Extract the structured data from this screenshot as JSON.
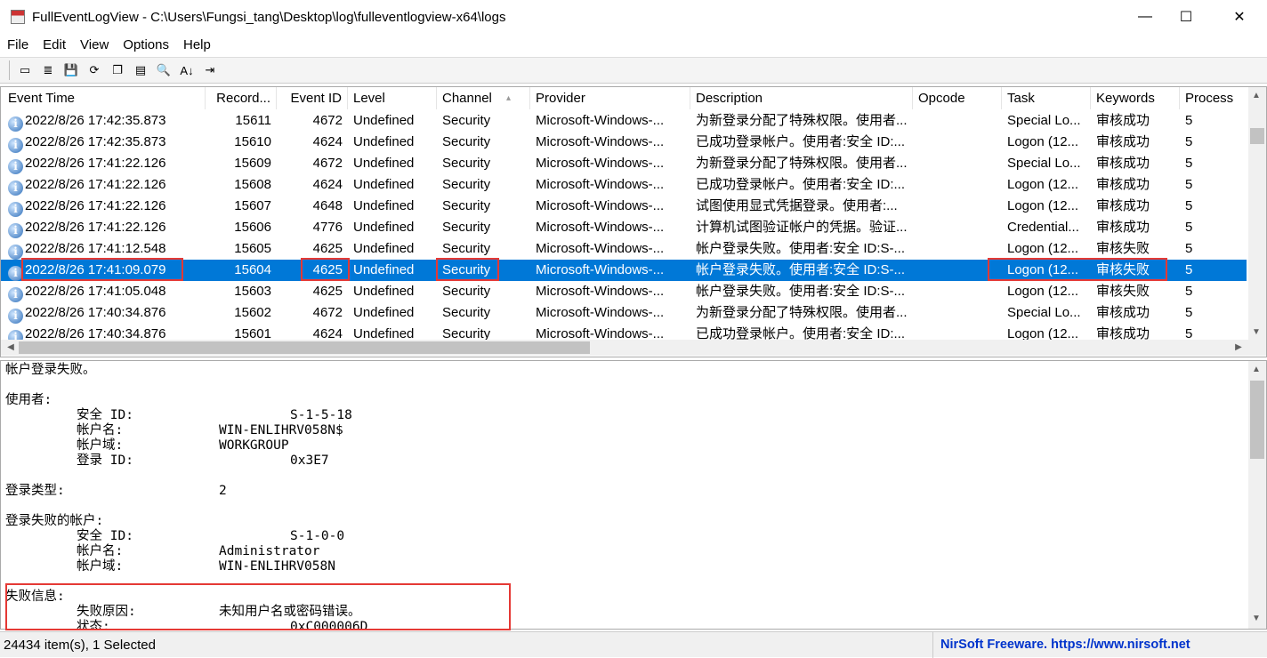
{
  "window": {
    "title": "FullEventLogView - C:\\Users\\Fungsi_tang\\Desktop\\log\\fulleventlogview-x64\\logs",
    "minimize": "—",
    "maximize": "☐",
    "close": "✕"
  },
  "menu": [
    "File",
    "Edit",
    "View",
    "Options",
    "Help"
  ],
  "toolbar": [
    {
      "icon": "properties-icon",
      "glyph": "▭"
    },
    {
      "icon": "database-icon",
      "glyph": "≣"
    },
    {
      "icon": "save-icon",
      "glyph": "💾"
    },
    {
      "icon": "refresh-icon",
      "glyph": "⟳"
    },
    {
      "icon": "copy-icon",
      "glyph": "❐"
    },
    {
      "icon": "html-report-icon",
      "glyph": "▤"
    },
    {
      "icon": "find-icon",
      "glyph": "🔍"
    },
    {
      "icon": "sort-icon",
      "glyph": "A↓"
    },
    {
      "icon": "exit-icon",
      "glyph": "⇥"
    }
  ],
  "columns": [
    "Event Time",
    "Record...",
    "Event ID",
    "Level",
    "Channel",
    "Provider",
    "Description",
    "Opcode",
    "Task",
    "Keywords",
    "Process"
  ],
  "rows": [
    [
      "2022/8/26 17:42:35.873",
      "15611",
      "4672",
      "Undefined",
      "Security",
      "Microsoft-Windows-...",
      "为新登录分配了特殊权限。使用者...",
      "",
      "Special Lo...",
      "审核成功",
      "5"
    ],
    [
      "2022/8/26 17:42:35.873",
      "15610",
      "4624",
      "Undefined",
      "Security",
      "Microsoft-Windows-...",
      "已成功登录帐户。使用者:安全 ID:...",
      "",
      "Logon (12...",
      "审核成功",
      "5"
    ],
    [
      "2022/8/26 17:41:22.126",
      "15609",
      "4672",
      "Undefined",
      "Security",
      "Microsoft-Windows-...",
      "为新登录分配了特殊权限。使用者...",
      "",
      "Special Lo...",
      "审核成功",
      "5"
    ],
    [
      "2022/8/26 17:41:22.126",
      "15608",
      "4624",
      "Undefined",
      "Security",
      "Microsoft-Windows-...",
      "已成功登录帐户。使用者:安全 ID:...",
      "",
      "Logon (12...",
      "审核成功",
      "5"
    ],
    [
      "2022/8/26 17:41:22.126",
      "15607",
      "4648",
      "Undefined",
      "Security",
      "Microsoft-Windows-...",
      "试图使用显式凭据登录。使用者:...",
      "",
      "Logon (12...",
      "审核成功",
      "5"
    ],
    [
      "2022/8/26 17:41:22.126",
      "15606",
      "4776",
      "Undefined",
      "Security",
      "Microsoft-Windows-...",
      "计算机试图验证帐户的凭据。验证...",
      "",
      "Credential...",
      "审核成功",
      "5"
    ],
    [
      "2022/8/26 17:41:12.548",
      "15605",
      "4625",
      "Undefined",
      "Security",
      "Microsoft-Windows-...",
      "帐户登录失败。使用者:安全 ID:S-...",
      "",
      "Logon (12...",
      "审核失败",
      "5"
    ],
    [
      "2022/8/26 17:41:09.079",
      "15604",
      "4625",
      "Undefined",
      "Security",
      "Microsoft-Windows-...",
      "帐户登录失败。使用者:安全 ID:S-...",
      "",
      "Logon (12...",
      "审核失败",
      "5"
    ],
    [
      "2022/8/26 17:41:05.048",
      "15603",
      "4625",
      "Undefined",
      "Security",
      "Microsoft-Windows-...",
      "帐户登录失败。使用者:安全 ID:S-...",
      "",
      "Logon (12...",
      "审核失败",
      "5"
    ],
    [
      "2022/8/26 17:40:34.876",
      "15602",
      "4672",
      "Undefined",
      "Security",
      "Microsoft-Windows-...",
      "为新登录分配了特殊权限。使用者...",
      "",
      "Special Lo...",
      "审核成功",
      "5"
    ],
    [
      "2022/8/26 17:40:34.876",
      "15601",
      "4624",
      "Undefined",
      "Security",
      "Microsoft-Windows-...",
      "已成功登录帐户。使用者:安全 ID:...",
      "",
      "Logon (12...",
      "审核成功",
      "5"
    ]
  ],
  "selected_row": 7,
  "sort_column": "Channel",
  "detail": "帐户登录失败。\n\n使用者:\n\t安全 ID:\t\t\tS-1-5-18\n\t帐户名:\t\tWIN-ENLIHRV058N$\n\t帐户域:\t\tWORKGROUP\n\t登录 ID:\t\t\t0x3E7\n\n登录类型:\t\t\t2\n\n登录失败的帐户:\n\t安全 ID:\t\t\tS-1-0-0\n\t帐户名:\t\tAdministrator\n\t帐户域:\t\tWIN-ENLIHRV058N\n\n失败信息:\n\t失败原因:\t\t未知用户名或密码错误。\n\t状态:\t\t\t0xC000006D",
  "status": {
    "items": "24434 item(s), 1 Selected",
    "credit": "NirSoft Freeware. https://www.nirsoft.net"
  },
  "colors": {
    "selection": "#0078d7",
    "annotation": "#e53935",
    "credit": "#0033cc"
  }
}
